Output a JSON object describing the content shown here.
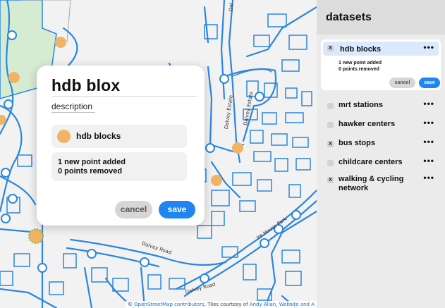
{
  "map": {
    "attribution_prefix": "© ",
    "attribution_link1": "OpenStreetMap contributors",
    "attribution_mid": ", Tiles courtesy of ",
    "attribution_link2": "Andy Allan",
    "attribution_sep": ", ",
    "attribution_link3": "Website and A",
    "road_labels": [
      "Dalvey Estate",
      "Dalvey Estate",
      "Dalvey Road",
      "Dalvey Road",
      "ire House Park",
      "Dal"
    ]
  },
  "popup": {
    "title": "hdb blox",
    "description_label": "description",
    "dataset_name": "hdb blocks",
    "added_text": "1 new point added",
    "removed_text": "0 points removed",
    "cancel_label": "cancel",
    "save_label": "save"
  },
  "panel": {
    "title": "datasets",
    "active": {
      "name": "hdb blocks",
      "checked": true,
      "added_text": "1 new point added",
      "removed_text": "0 points removed",
      "cancel_label": "cancel",
      "save_label": "save",
      "menu": "•••"
    },
    "items": [
      {
        "name": "mrt stations",
        "checked": false,
        "menu": "•••"
      },
      {
        "name": "hawker centers",
        "checked": false,
        "menu": "•••"
      },
      {
        "name": "bus stops",
        "checked": true,
        "menu": "•••"
      },
      {
        "name": "childcare centers",
        "checked": false,
        "menu": "•••"
      },
      {
        "name": "walking & cycling network",
        "checked": true,
        "menu": "•••"
      }
    ],
    "check_mark": "X"
  },
  "colors": {
    "accent": "#2185f0",
    "marker": "#f0b464",
    "road": "#2a86e0",
    "building": "#2a86e0",
    "park": "#d6ecd2"
  }
}
